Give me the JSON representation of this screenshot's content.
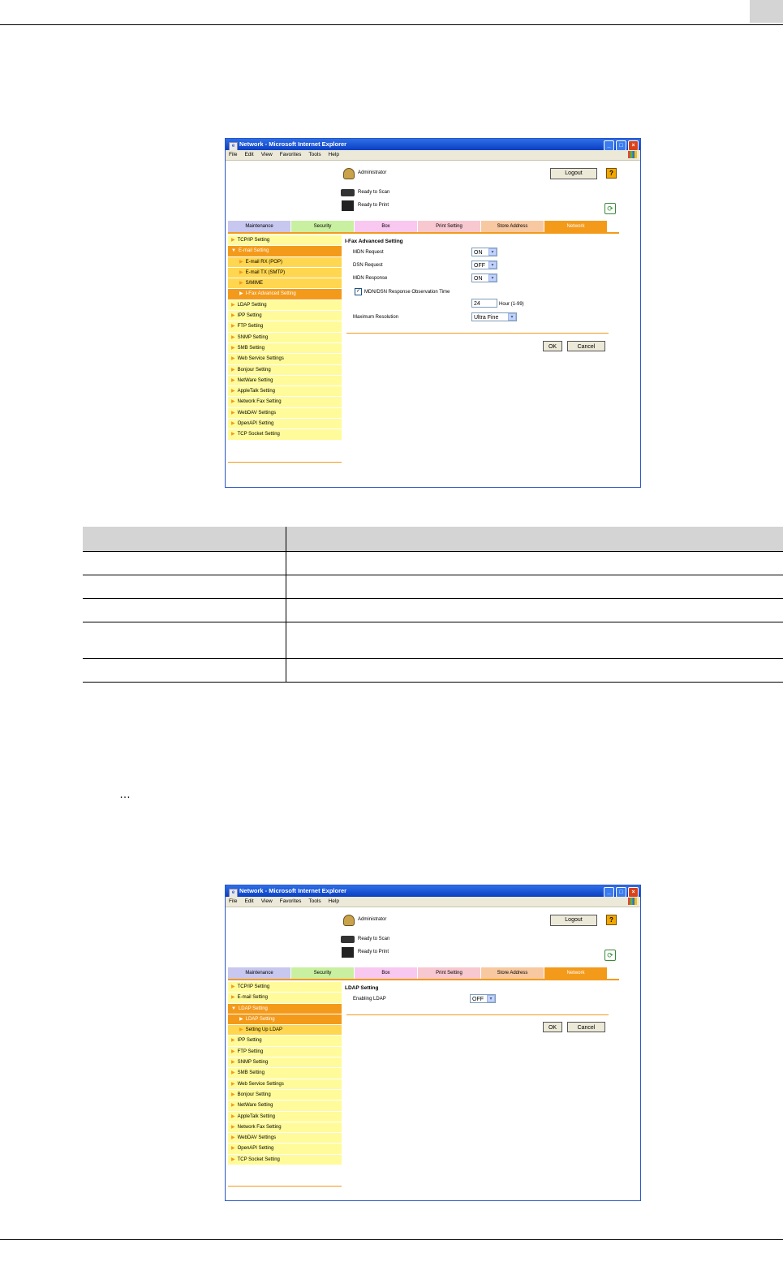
{
  "window_title": "Network - Microsoft Internet Explorer",
  "menu": [
    "File",
    "Edit",
    "View",
    "Favorites",
    "Tools",
    "Help"
  ],
  "ellipsis": "…",
  "header": {
    "administrator": "Administrator",
    "logout": "Logout",
    "help": "?",
    "ready_scan": "Ready to Scan",
    "ready_print": "Ready to Print"
  },
  "tabs": [
    "Maintenance",
    "Security",
    "Box",
    "Print Setting",
    "Store Address",
    "Network"
  ],
  "tab_colors": [
    "#c7c7f0",
    "#c8f0a0",
    "#f8c8f0",
    "#f8c8d0",
    "#f8c8a0",
    "#f39a1b"
  ],
  "shot1": {
    "sidebar": [
      "TCP/IP Setting",
      "E-mail Setting",
      "E-mail RX (POP)",
      "E-mail TX (SMTP)",
      "S/MIME",
      "I-Fax Advanced Setting",
      "LDAP Setting",
      "IPP Setting",
      "FTP Setting",
      "SNMP Setting",
      "SMB Setting",
      "Web Service Settings",
      "Bonjour Setting",
      "NetWare Setting",
      "AppleTalk Setting",
      "Network Fax Setting",
      "WebDAV Settings",
      "OpenAPI Setting",
      "TCP Socket Setting"
    ],
    "form": {
      "title": "I-Fax Advanced Setting",
      "mdn_request_label": "MDN Request",
      "mdn_request_value": "ON",
      "dsn_request_label": "DSN Request",
      "dsn_request_value": "OFF",
      "mdn_response_label": "MDN Response",
      "mdn_response_value": "ON",
      "observation_label": "MDN/DSN Response Observation Time",
      "observation_value": "24",
      "observation_unit": "Hour (1-99)",
      "max_res_label": "Maximum Resolution",
      "max_res_value": "Ultra Fine",
      "ok": "OK",
      "cancel": "Cancel"
    }
  },
  "shot2": {
    "sidebar": [
      "TCP/IP Setting",
      "E-mail Setting",
      "LDAP Setting",
      "LDAP Setting",
      "Setting Up LDAP",
      "IPP Setting",
      "FTP Setting",
      "SNMP Setting",
      "SMB Setting",
      "Web Service Settings",
      "Bonjour Setting",
      "NetWare Setting",
      "AppleTalk Setting",
      "Network Fax Setting",
      "WebDAV Settings",
      "OpenAPI Setting",
      "TCP Socket Setting"
    ],
    "form": {
      "title": "LDAP Setting",
      "enabling_label": "Enabling LDAP",
      "enabling_value": "OFF",
      "ok": "OK",
      "cancel": "Cancel"
    }
  },
  "checkmark": "✓",
  "dropdown_arrow": "▾",
  "refresh_glyph": "⟳"
}
